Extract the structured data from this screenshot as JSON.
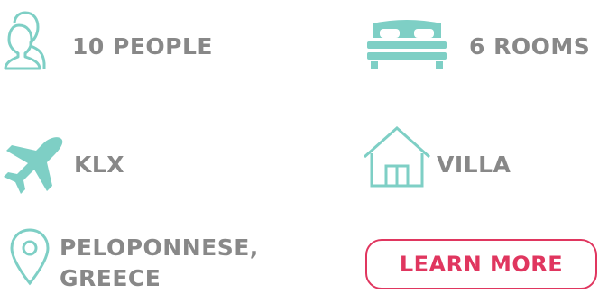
{
  "features": {
    "people": {
      "label": "10 PEOPLE",
      "icon": "people-icon"
    },
    "rooms": {
      "label": "6 ROOMS",
      "icon": "bed-icon"
    },
    "airport": {
      "label": "KLX",
      "icon": "airplane-icon"
    },
    "type": {
      "label": "VILLA",
      "icon": "house-icon"
    },
    "location": {
      "line1": "PELOPONNESE,",
      "line2": "GREECE",
      "icon": "location-pin-icon"
    }
  },
  "cta": {
    "label": "LEARN MORE"
  },
  "colors": {
    "accent": "#7ecfc5",
    "text": "#888888",
    "cta": "#e0365f"
  }
}
